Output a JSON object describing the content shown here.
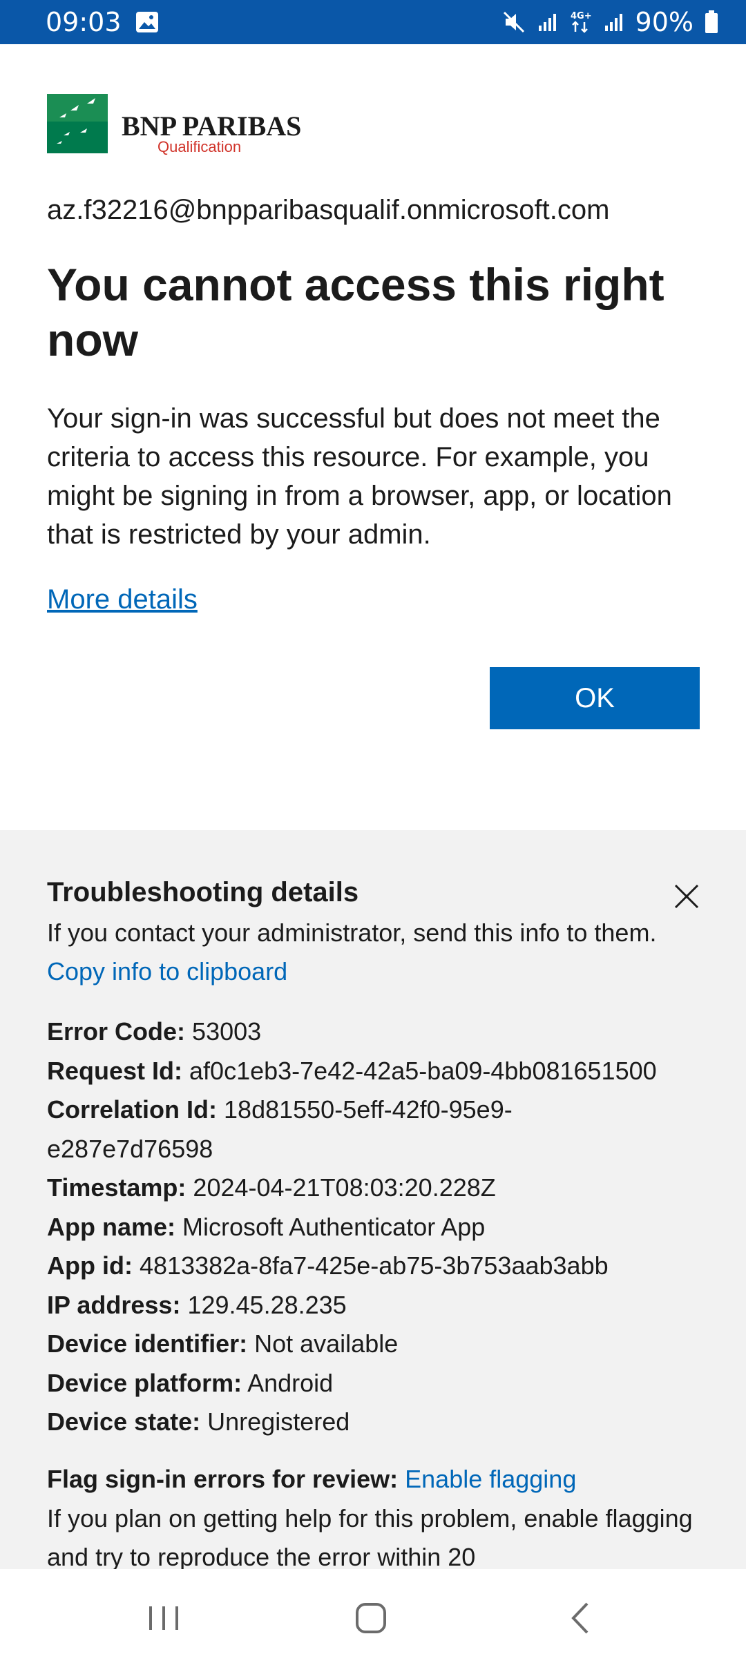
{
  "status_bar": {
    "time": "09:03",
    "battery": "90%",
    "icons": [
      "gallery-icon",
      "mute-icon",
      "signal-icon",
      "4g-icon",
      "signal-icon",
      "battery-icon"
    ]
  },
  "brand": {
    "name": "BNP PARIBAS",
    "subtitle": "Qualification",
    "color": "#007a4d"
  },
  "account": "az.f32216@bnpparibasqualif.onmicrosoft.com",
  "title": "You cannot access this right now",
  "description": "Your sign-in was successful but does not meet the criteria to access this resource. For example, you might be signing in from a browser, app, or location that is restricted by your admin.",
  "more_details_link": "More details",
  "ok_button": "OK",
  "troubleshooting": {
    "title": "Troubleshooting details",
    "subtitle": "If you contact your administrator, send this info to them.",
    "copy_link": "Copy info to clipboard",
    "details": [
      {
        "label": "Error Code:",
        "value": "53003"
      },
      {
        "label": "Request Id:",
        "value": "af0c1eb3-7e42-42a5-ba09-4bb081651500"
      },
      {
        "label": "Correlation Id:",
        "value": "18d81550-5eff-42f0-95e9-e287e7d76598"
      },
      {
        "label": "Timestamp:",
        "value": "2024-04-21T08:03:20.228Z"
      },
      {
        "label": "App name:",
        "value": "Microsoft Authenticator App"
      },
      {
        "label": "App id:",
        "value": "4813382a-8fa7-425e-ab75-3b753aab3abb"
      },
      {
        "label": "IP address:",
        "value": "129.45.28.235"
      },
      {
        "label": "Device identifier:",
        "value": "Not available"
      },
      {
        "label": "Device platform:",
        "value": "Android"
      },
      {
        "label": "Device state:",
        "value": "Unregistered"
      }
    ],
    "flag_label": "Flag sign-in errors for review:",
    "flag_link": "Enable flagging",
    "flag_text": "If you plan on getting help for this problem, enable flagging and try to reproduce the error within 20"
  },
  "colors": {
    "status_bar": "#0a57a8",
    "accent": "#0067b8",
    "panel": "#f2f2f2"
  }
}
